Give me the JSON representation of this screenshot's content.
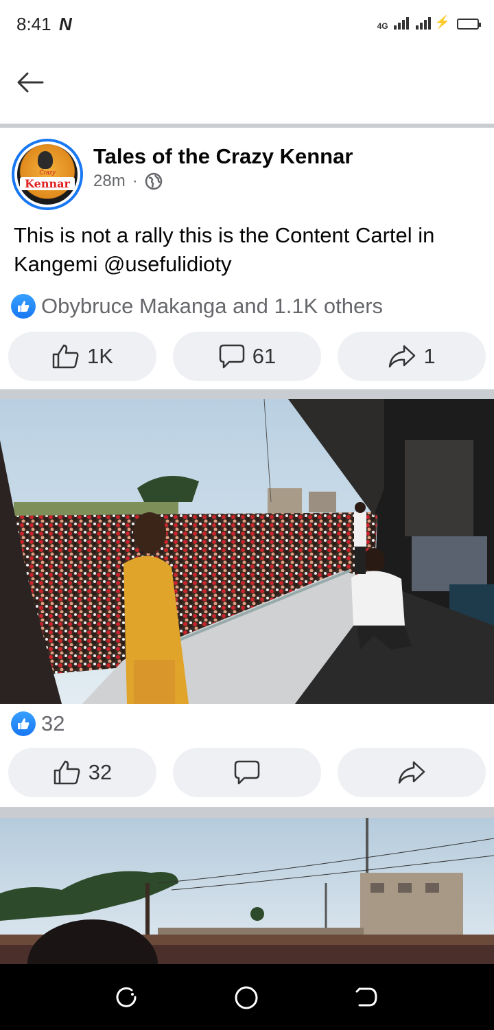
{
  "status_bar": {
    "time": "8:41",
    "carrier_glyph": "N",
    "network": "4G"
  },
  "post": {
    "page_name": "Tales of the Crazy Kennar",
    "time_ago": "28m",
    "separator": "·",
    "avatar_text": "Kennar",
    "avatar_small_text": "Crazy",
    "text": "This is not a rally this is the Content Cartel in Kangemi @usefulidioty",
    "reactions_summary": "Obybruce Makanga and 1.1K others",
    "actions": {
      "like_count": "1K",
      "comment_count": "61",
      "share_count": "1"
    }
  },
  "photo1": {
    "reaction_count": "32",
    "actions": {
      "like_count": "32"
    }
  },
  "icons": {
    "back": "arrow-left-icon",
    "globe": "globe-icon",
    "like": "thumbs-up-icon",
    "comment": "comment-bubble-icon",
    "share": "share-arrow-icon"
  },
  "colors": {
    "accent": "#1877f2",
    "divider": "#c9ccd1",
    "button_bg": "#eef0f3",
    "secondary_text": "#65676b"
  }
}
